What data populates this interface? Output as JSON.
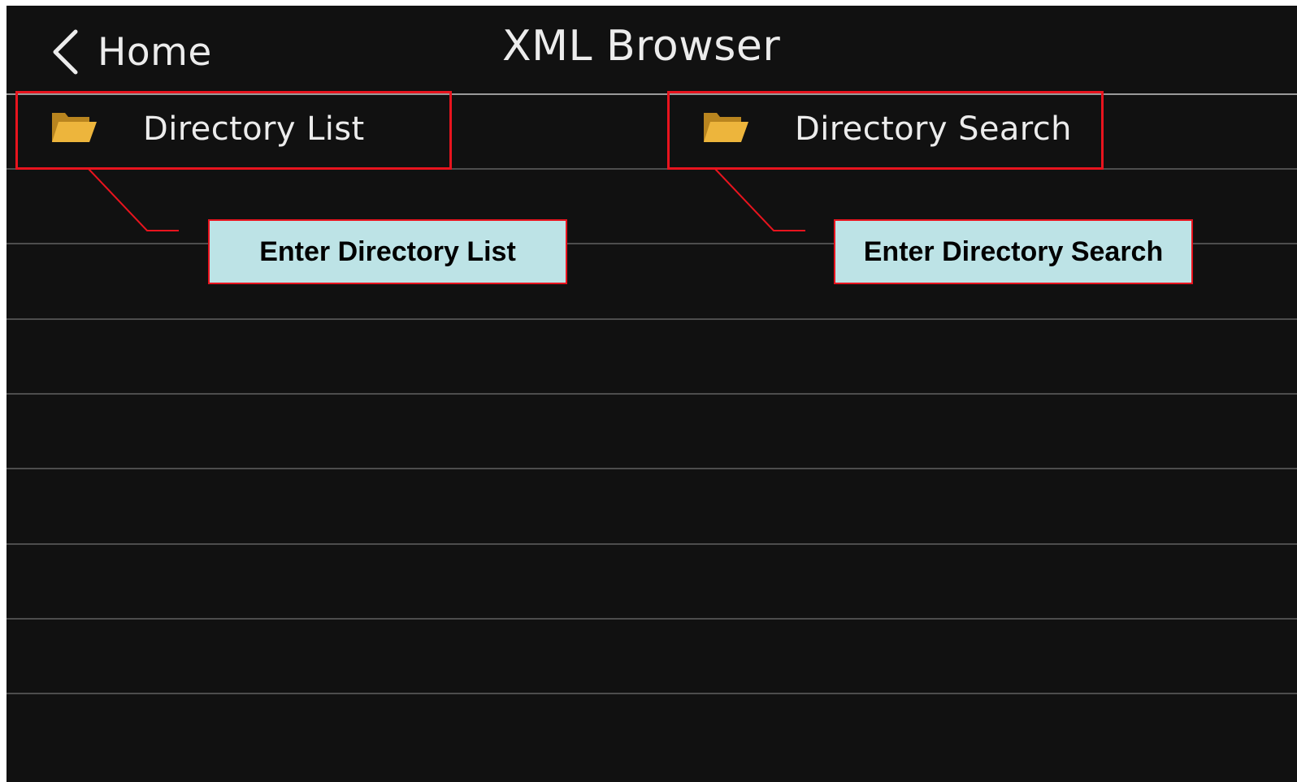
{
  "header": {
    "back_label": "Home",
    "title": "XML Browser"
  },
  "menu": {
    "items": [
      {
        "label": "Directory List",
        "icon": "folder-open-icon"
      },
      {
        "label": "Directory Search",
        "icon": "folder-open-icon"
      }
    ]
  },
  "annotations": [
    {
      "text": "Enter Directory List"
    },
    {
      "text": "Enter Directory Search"
    }
  ],
  "colors": {
    "background": "#111111",
    "text": "#ececec",
    "folder": "#e9b13a",
    "highlight": "#e8141e",
    "callout_fill": "#bde3e6"
  }
}
